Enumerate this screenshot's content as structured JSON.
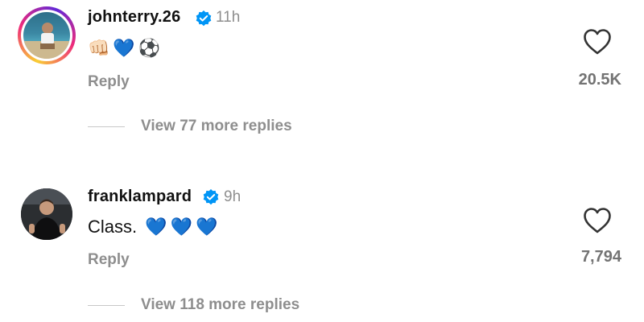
{
  "comments": [
    {
      "username": "johnterry.26",
      "time": "11h",
      "text": "",
      "emojis": [
        "👊🏻",
        "💙",
        "⚽"
      ],
      "reply_label": "Reply",
      "like_count": "20.5K",
      "more_replies": "View 77 more replies"
    },
    {
      "username": "franklampard",
      "time": "9h",
      "text": "Class.",
      "emojis": [
        "💙",
        "💙",
        "💙"
      ],
      "reply_label": "Reply",
      "like_count": "7,794",
      "more_replies": "View 118 more replies"
    }
  ],
  "colors": {
    "verified_blue": "#0095f6",
    "heart_blue": "#1877f2",
    "muted_text": "#8e8e8e"
  },
  "icons": {
    "verified": "verified-badge-icon",
    "like": "heart-outline-icon"
  }
}
